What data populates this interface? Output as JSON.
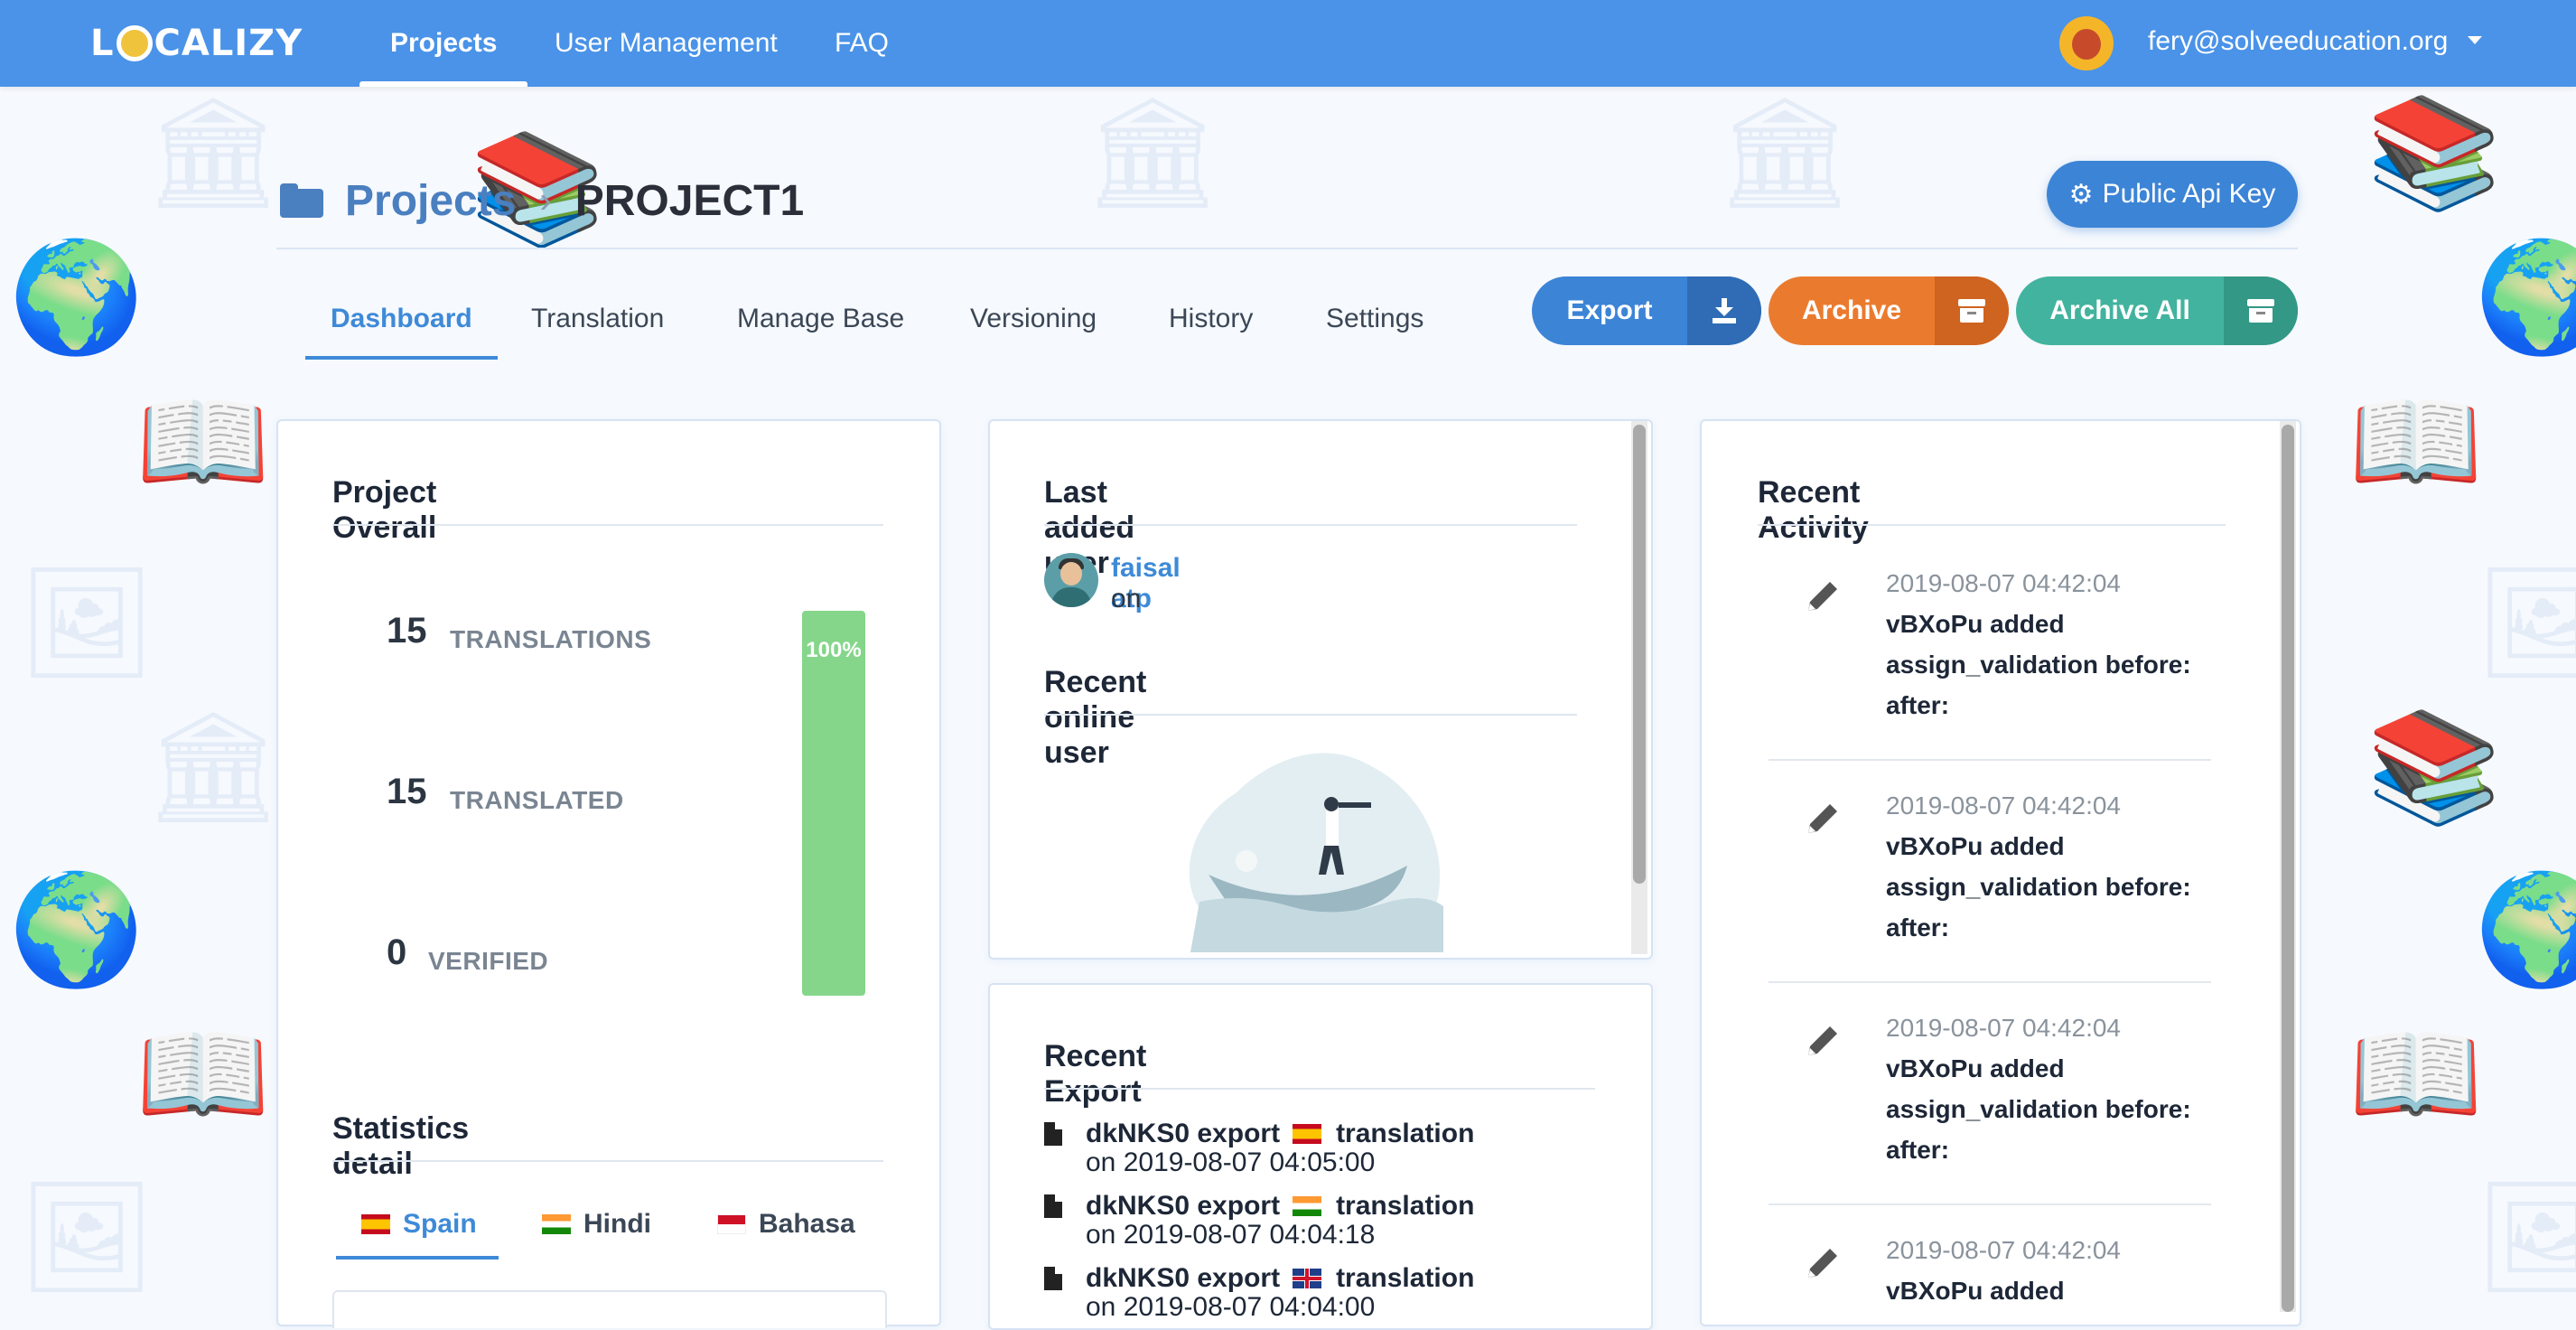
{
  "nav": {
    "logo": "LOCALIZY",
    "items": [
      "Projects",
      "User Management",
      "FAQ"
    ],
    "user_email": "fery@solveeducation.org"
  },
  "header": {
    "crumb_root": "Projects",
    "crumb_current": "PROJECT1",
    "api_key_button": "Public Api Key"
  },
  "tabs": [
    "Dashboard",
    "Translation",
    "Manage Base",
    "Versioning",
    "History",
    "Settings"
  ],
  "actions": {
    "export": "Export",
    "archive": "Archive",
    "archive_all": "Archive All"
  },
  "project_overall": {
    "title": "Project Overall",
    "stats": [
      {
        "value": "15",
        "label": "TRANSLATIONS"
      },
      {
        "value": "15",
        "label": "TRANSLATED"
      },
      {
        "value": "0",
        "label": "VERIFIED"
      }
    ],
    "progress": 1.0,
    "progress_label": "100%"
  },
  "statistics_detail": {
    "title": "Statistics detail",
    "languages": [
      {
        "name": "Spain",
        "flag": "es"
      },
      {
        "name": "Hindi",
        "flag": "in"
      },
      {
        "name": "Bahasa",
        "flag": "id"
      }
    ]
  },
  "last_added_user": {
    "title": "Last added user",
    "name": "faisal atp",
    "on": "on"
  },
  "recent_online_user": {
    "title": "Recent online user"
  },
  "recent_export": {
    "title": "Recent Export",
    "items": [
      {
        "main": "dkNKS0 export",
        "flag": "es",
        "type": "translation",
        "date": "on 2019-08-07 04:05:00"
      },
      {
        "main": "dkNKS0 export",
        "flag": "in",
        "type": "translation",
        "date": "on 2019-08-07 04:04:18"
      },
      {
        "main": "dkNKS0 export",
        "flag": "gb",
        "type": "translation",
        "date": "on 2019-08-07 04:04:00"
      }
    ]
  },
  "recent_activity": {
    "title": "Recent Activity",
    "items": [
      {
        "time": "2019-08-07 04:42:04",
        "text": "vBXoPu added assign_validation before: after:"
      },
      {
        "time": "2019-08-07 04:42:04",
        "text": "vBXoPu added assign_validation before: after:"
      },
      {
        "time": "2019-08-07 04:42:04",
        "text": "vBXoPu added assign_validation before: after:"
      },
      {
        "time": "2019-08-07 04:42:04",
        "text": "vBXoPu added"
      }
    ]
  },
  "icons": {
    "logo_globe": "globe-icon",
    "folder": "folder-icon",
    "api": "gear-icon",
    "export": "download-icon",
    "archive": "archive-box-icon",
    "activity": "pencil-icon",
    "export_file": "file-icon"
  },
  "colors": {
    "topbar": "#4a93e8",
    "primary": "#3c84d6",
    "archive": "#ea7b2e",
    "archive_all": "#42b39e",
    "progress": "#85d68a"
  }
}
